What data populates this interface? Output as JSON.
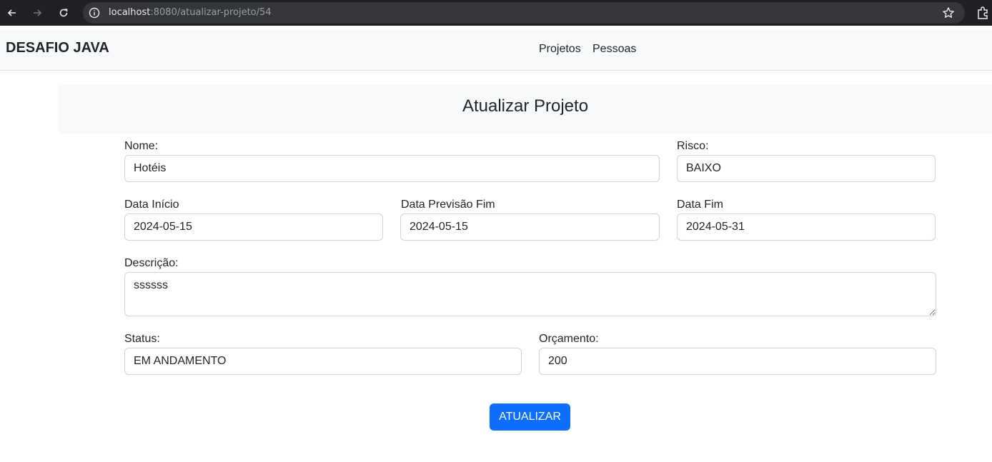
{
  "browser": {
    "url_host": "localhost",
    "url_path": ":8080/atualizar-projeto/54"
  },
  "navbar": {
    "brand": "DESAFIO JAVA",
    "links": [
      "Projetos",
      "Pessoas"
    ]
  },
  "page": {
    "title": "Atualizar Projeto"
  },
  "form": {
    "nome": {
      "label": "Nome:",
      "value": "Hotéis"
    },
    "risco": {
      "label": "Risco:",
      "value": "BAIXO"
    },
    "data_inicio": {
      "label": "Data Início",
      "value": "2024-05-15"
    },
    "data_previsao_fim": {
      "label": "Data Previsão Fim",
      "value": "2024-05-15"
    },
    "data_fim": {
      "label": "Data Fim",
      "value": "2024-05-31"
    },
    "descricao": {
      "label": "Descrição:",
      "value": "ssssss"
    },
    "status": {
      "label": "Status:",
      "value": "EM ANDAMENTO"
    },
    "orcamento": {
      "label": "Orçamento:",
      "value": "200"
    },
    "submit_label": "ATUALIZAR"
  },
  "colors": {
    "primary": "#0d6efd",
    "navbar_bg": "#f8f9fa",
    "chrome_bg": "#202124"
  }
}
